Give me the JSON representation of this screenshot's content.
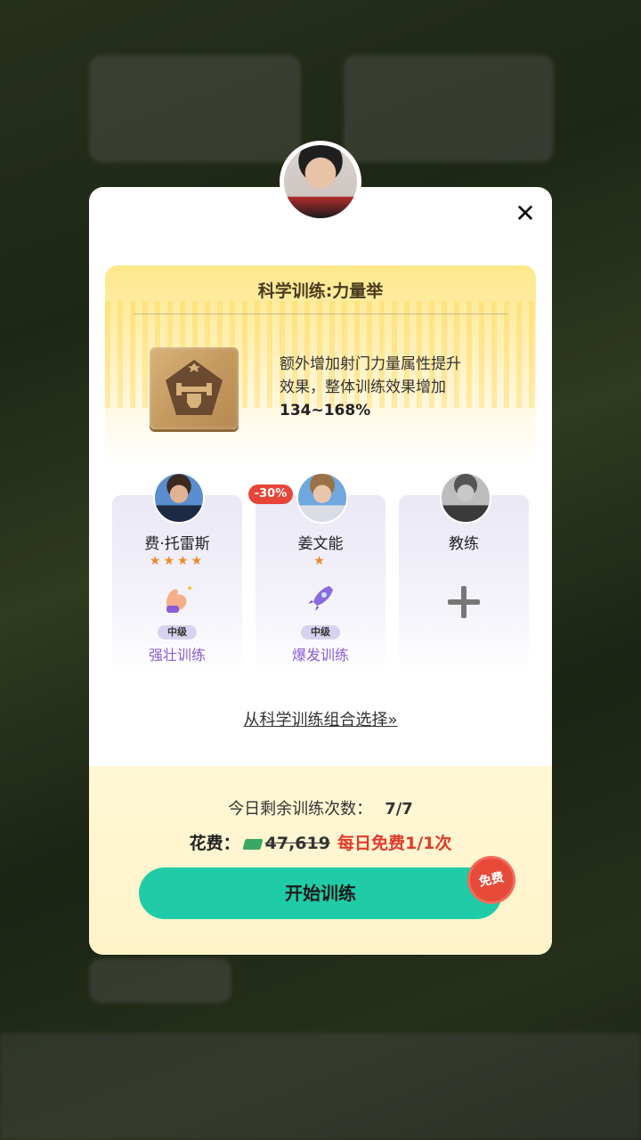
{
  "banner": {
    "title": "科学训练:力量举",
    "desc_line1": "额外增加射门力量属性提升",
    "desc_line2": "效果，整体训练效果增加",
    "desc_value": "134~168%",
    "skill_icon": "dumbbell-fist-icon"
  },
  "coaches": [
    {
      "name": "费·托雷斯",
      "stars": "★★★★",
      "star_count": 4,
      "level": "中级",
      "trait": "强壮训练",
      "trait_icon": "flexed-bicep-icon"
    },
    {
      "name": "姜文能",
      "stars": "★",
      "star_count": 1,
      "level": "中级",
      "trait": "爆发训练",
      "trait_icon": "rocket-icon",
      "discount": "-30%"
    },
    {
      "name": "教练",
      "empty_slot": true
    }
  ],
  "select_link": "从科学训练组合选择»",
  "remaining": {
    "label": "今日剩余训练次数：",
    "value": "7/7"
  },
  "cost": {
    "label": "花费：",
    "old_price": "47,619",
    "free_text": "每日免费1/1次"
  },
  "start_button": "开始训练",
  "free_badge": "免费",
  "colors": {
    "accent_green": "#1fcca7",
    "discount_red": "#e8453a",
    "trait_purple": "#8a5cd8",
    "star_orange": "#f0882a"
  }
}
